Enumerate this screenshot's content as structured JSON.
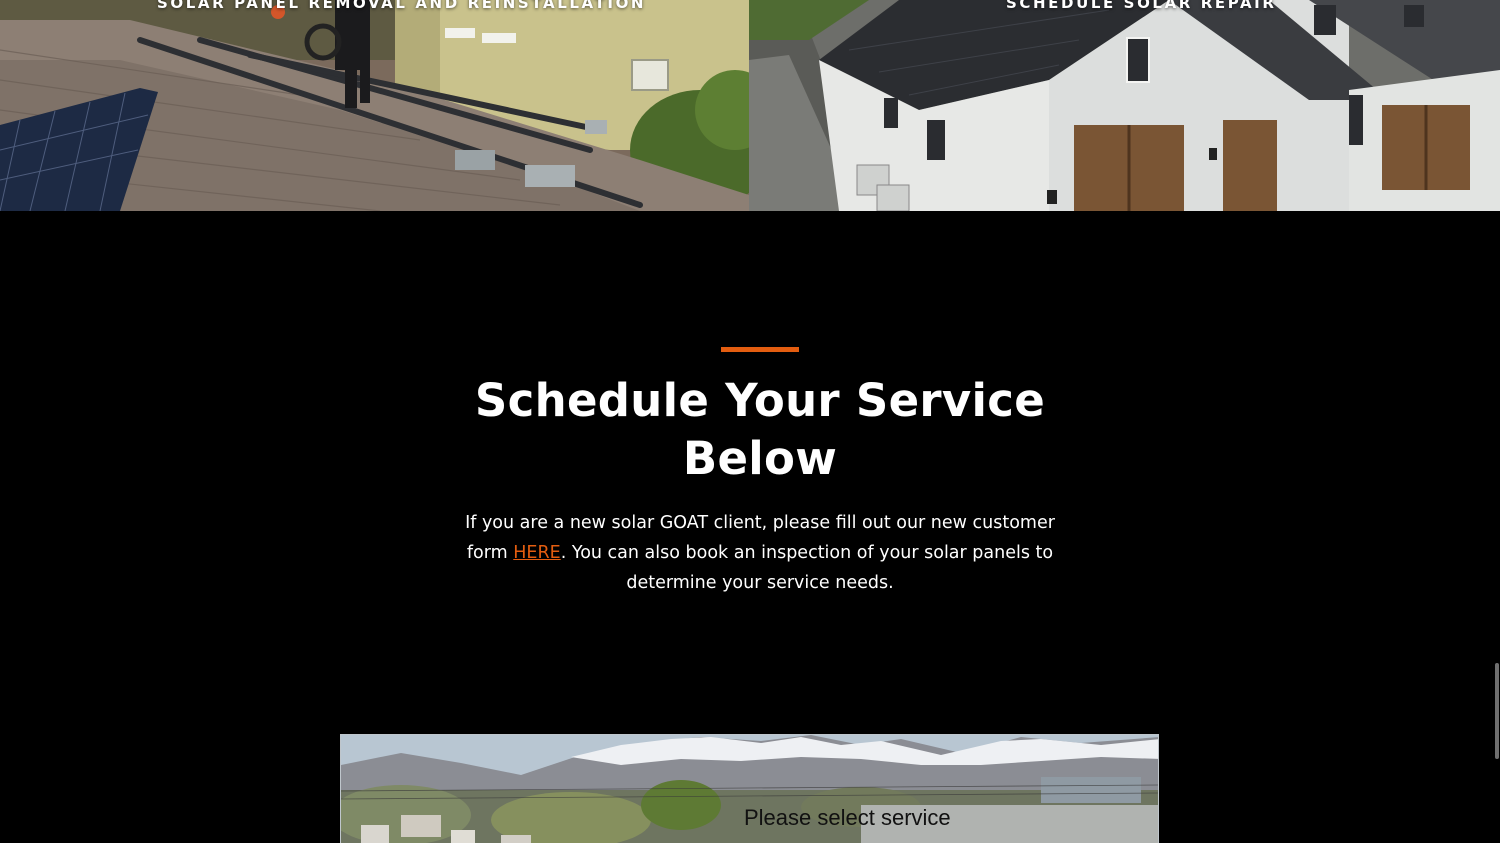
{
  "tiles": [
    {
      "title": "SOLAR PANEL REMOVAL AND REINSTALLATION"
    },
    {
      "title": "SCHEDULE SOLAR REPAIR"
    }
  ],
  "schedule": {
    "heading": "Schedule Your Service Below",
    "text_before_link": "If you are a new solar GOAT client, please fill out our new customer form ",
    "link_text": "HERE",
    "text_after_link": ". You can also book an inspection of your solar panels to determine your service needs."
  },
  "widget": {
    "select_label": "Please select service"
  },
  "colors": {
    "accent": "#e35d10",
    "background": "#000000",
    "text": "#ffffff"
  }
}
